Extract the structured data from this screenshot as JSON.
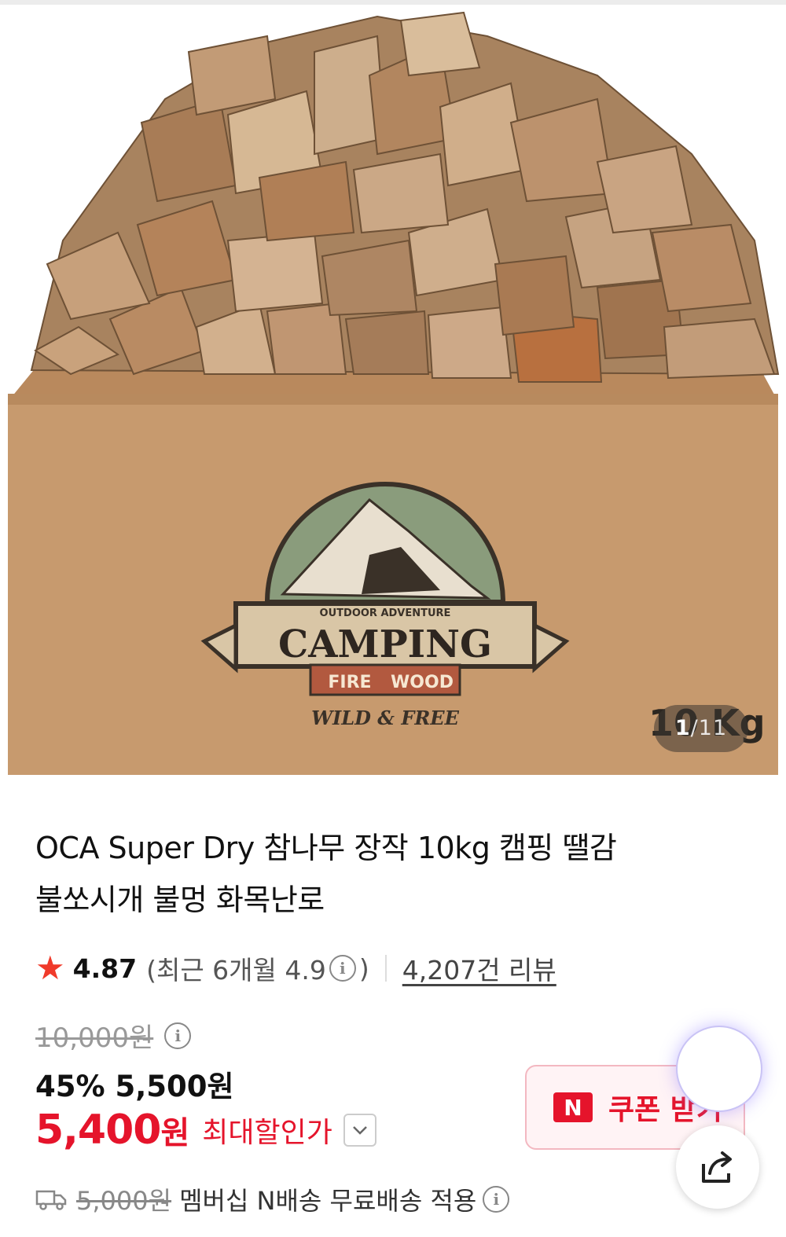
{
  "gallery": {
    "current": "1",
    "total": "/11",
    "box_logo": {
      "top_text": "OUTDOOR ADVENTURE",
      "main_text": "CAMPING",
      "fire": "FIRE",
      "wood": "WOOD",
      "tagline": "WILD & FREE",
      "weight": "10 Kg"
    }
  },
  "product": {
    "title_line1": "OCA Super Dry 참나무 장작 10kg 캠핑 땔감",
    "title_line2": "불쏘시개 불멍 화목난로"
  },
  "rating": {
    "score": "4.87",
    "recent_open": "(최근 6개월 4.9",
    "recent_close": ")",
    "review_link": "4,207건 리뷰"
  },
  "price": {
    "original": "10,000원",
    "discount": "45% 5,500원",
    "final_amount": "5,400",
    "final_unit": "원",
    "final_label": "최대할인가"
  },
  "shipping": {
    "fee": "5,000원",
    "text": "멤버십 N배송 무료배송 적용"
  },
  "coupon": {
    "badge": "N",
    "label": "쿠폰 받기"
  },
  "icons": {
    "star": "star-icon",
    "info": "info-icon",
    "chevron": "chevron-down-icon",
    "truck": "truck-icon",
    "share": "share-icon"
  },
  "colors": {
    "accent_red": "#e5142b",
    "star": "#f03a2a",
    "box": "#c79a6e"
  }
}
